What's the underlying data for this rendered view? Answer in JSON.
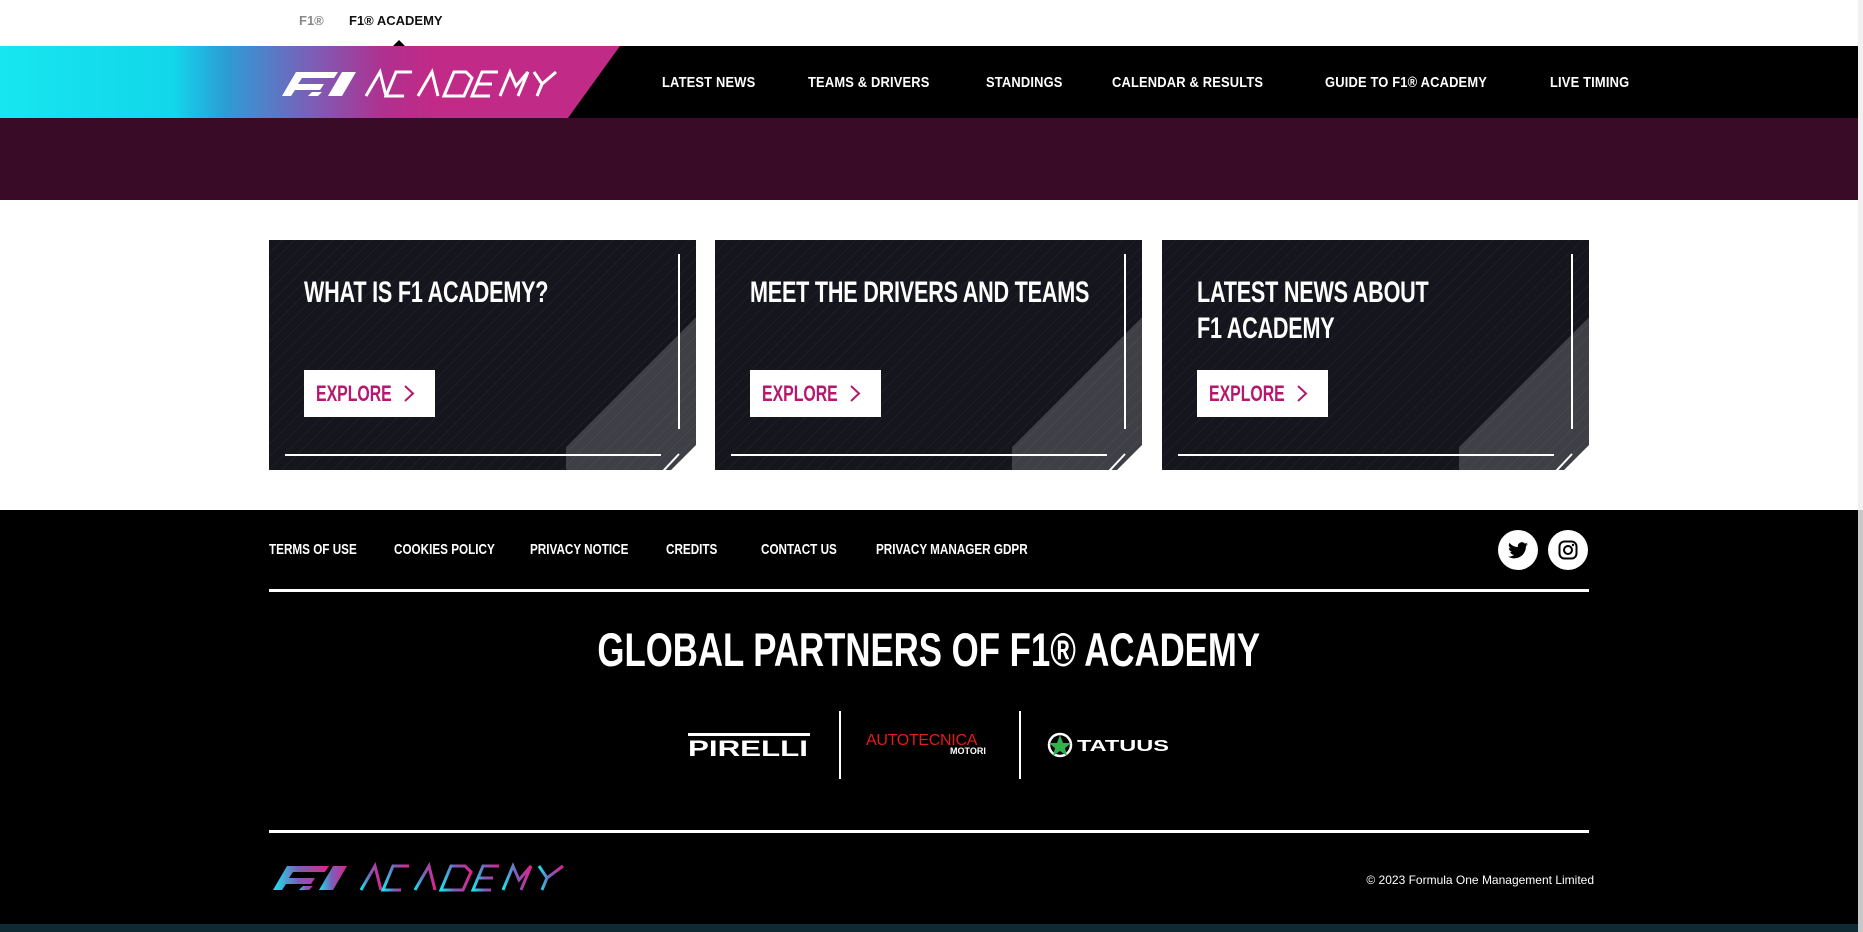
{
  "top_bar": {
    "f1_label": "F1®",
    "academy_label": "F1® ACADEMY"
  },
  "nav": {
    "logo_alt": "F1 ACADEMY",
    "items": [
      {
        "label": "LATEST NEWS"
      },
      {
        "label": "TEAMS & DRIVERS"
      },
      {
        "label": "STANDINGS"
      },
      {
        "label": "CALENDAR & RESULTS"
      },
      {
        "label": "GUIDE TO F1® ACADEMY"
      },
      {
        "label": "LIVE TIMING"
      }
    ],
    "gradient_colors": [
      "#17e6f0",
      "#c12a86"
    ]
  },
  "hero": {
    "background": "#3a0b26"
  },
  "cards": [
    {
      "title_line1": "WHAT IS F1 ACADEMY?",
      "title_line2": "",
      "button_label": "EXPLORE"
    },
    {
      "title_line1": "MEET THE DRIVERS AND TEAMS",
      "title_line2": "",
      "button_label": "EXPLORE"
    },
    {
      "title_line1": "LATEST NEWS ABOUT",
      "title_line2": "F1 ACADEMY",
      "button_label": "EXPLORE"
    }
  ],
  "footer": {
    "links": [
      {
        "label": "TERMS OF USE"
      },
      {
        "label": "COOKIES POLICY"
      },
      {
        "label": "PRIVACY NOTICE"
      },
      {
        "label": "CREDITS"
      },
      {
        "label": "CONTACT US"
      },
      {
        "label": "PRIVACY MANAGER GDPR"
      }
    ],
    "social": [
      {
        "icon": "twitter-icon"
      },
      {
        "icon": "instagram-icon"
      }
    ],
    "partners_title": "GLOBAL PARTNERS OF F1® ACADEMY",
    "partners": [
      {
        "name": "PIRELLI"
      },
      {
        "name": "AUTOTECNICA",
        "sub": "MOTORI"
      },
      {
        "name": "TATUUS"
      }
    ],
    "copyright": "© 2023 Formula One Management Limited"
  },
  "colors": {
    "accent_magenta": "#b7186e",
    "card_bg": "#15151e",
    "footer_bg": "#000000"
  }
}
